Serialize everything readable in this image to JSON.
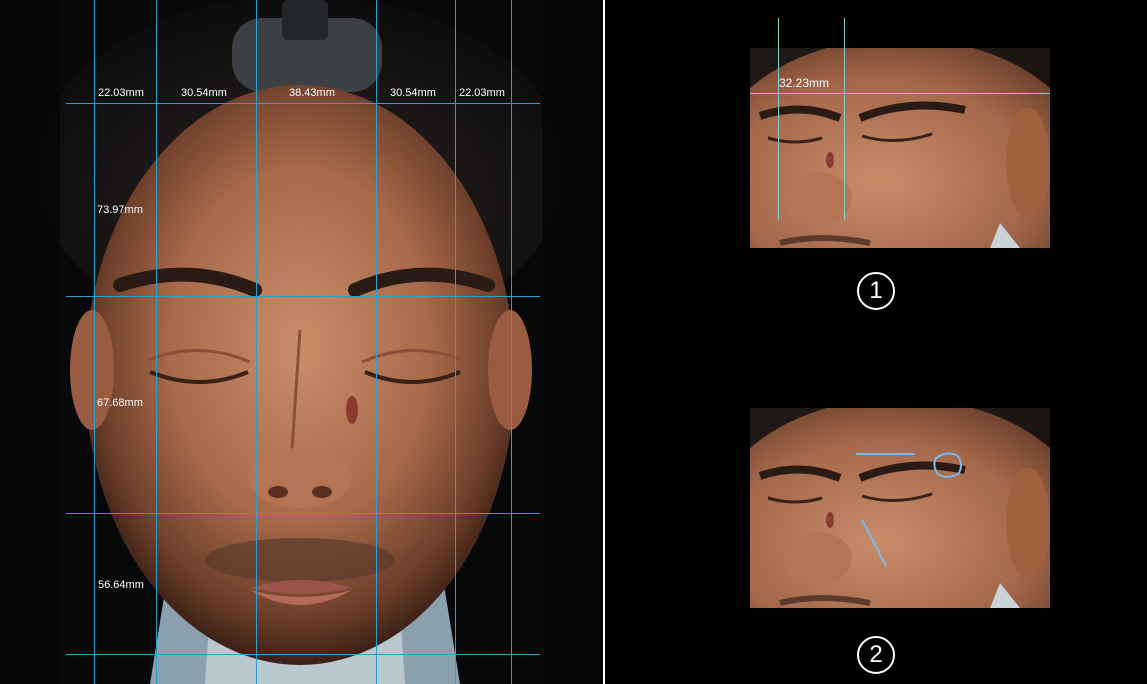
{
  "main_photo": {
    "column_widths": [
      "22.03mm",
      "30.54mm",
      "38.43mm",
      "30.54mm",
      "22.03mm"
    ],
    "row_heights": [
      "73.97mm",
      "67.68mm",
      "56.64mm"
    ],
    "grid_color": "#2a9fd0"
  },
  "view1": {
    "measurement": "32.23mm",
    "badge": "1",
    "guide_color": "#7fd0c8"
  },
  "view2": {
    "badge": "2",
    "annotation_color": "#7fb8e8"
  }
}
